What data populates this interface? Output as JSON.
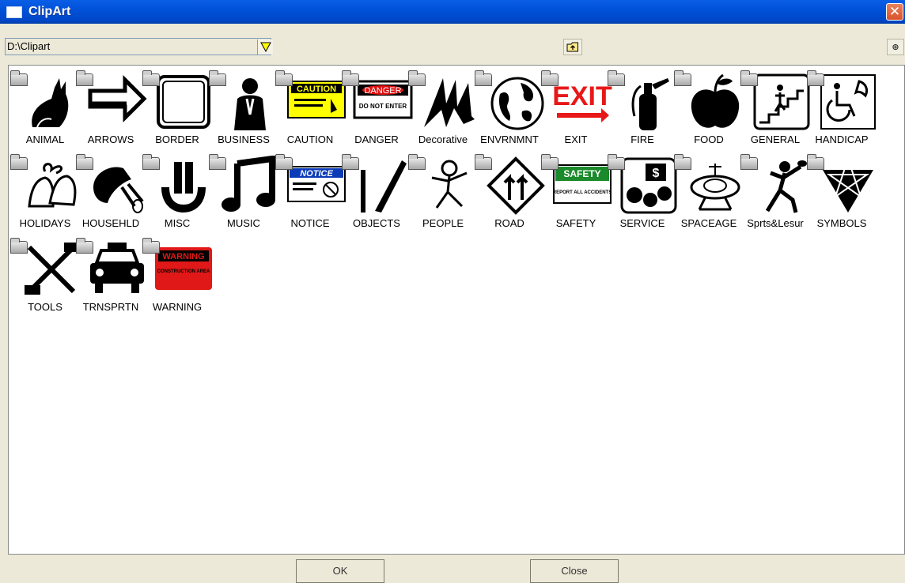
{
  "window": {
    "title": "ClipArt"
  },
  "path": {
    "value": "D:\\Clipart"
  },
  "folders": [
    {
      "label": "ANIMAL"
    },
    {
      "label": "ARROWS"
    },
    {
      "label": "BORDER"
    },
    {
      "label": "BUSINESS"
    },
    {
      "label": "CAUTION"
    },
    {
      "label": "DANGER"
    },
    {
      "label": "Decorative"
    },
    {
      "label": "ENVRNMNT"
    },
    {
      "label": "EXIT"
    },
    {
      "label": "FIRE"
    },
    {
      "label": "FOOD"
    },
    {
      "label": "GENERAL"
    },
    {
      "label": "HANDICAP"
    },
    {
      "label": "HOLIDAYS"
    },
    {
      "label": "HOUSEHLD"
    },
    {
      "label": "MISC"
    },
    {
      "label": "MUSIC"
    },
    {
      "label": "NOTICE"
    },
    {
      "label": "OBJECTS"
    },
    {
      "label": "PEOPLE"
    },
    {
      "label": "ROAD"
    },
    {
      "label": "SAFETY"
    },
    {
      "label": "SERVICE"
    },
    {
      "label": "SPACEAGE"
    },
    {
      "label": "Sprts&Lesur"
    },
    {
      "label": "SYMBOLS"
    },
    {
      "label": "TOOLS"
    },
    {
      "label": "TRNSPRTN"
    },
    {
      "label": "WARNING"
    }
  ],
  "sign_text": {
    "caution": "CAUTION",
    "danger": "DANGER",
    "danger_sub": "DO NOT ENTER",
    "exit": "EXIT",
    "notice": "NOTICE",
    "safety": "SAFETY",
    "safety_sub": "REPORT ALL ACCIDENTS",
    "warning": "WARNING",
    "warning_sub": "CONSTRUCTION AREA"
  },
  "buttons": {
    "ok": "OK",
    "close": "Close",
    "find": "Ψ"
  }
}
